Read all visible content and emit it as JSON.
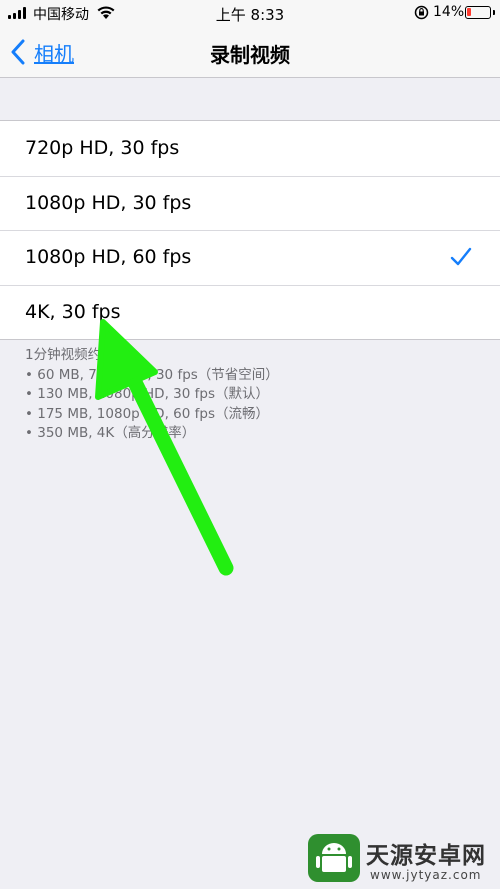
{
  "status_bar": {
    "carrier": "中国移动",
    "time": "上午 8:33",
    "battery_percent": "14%"
  },
  "nav": {
    "back_label": "相机",
    "title": "录制视频"
  },
  "options": [
    {
      "label": "720p HD, 30 fps",
      "selected": false
    },
    {
      "label": "1080p HD, 30 fps",
      "selected": false
    },
    {
      "label": "1080p HD, 60 fps",
      "selected": true
    },
    {
      "label": "4K, 30 fps",
      "selected": false
    }
  ],
  "footer": {
    "heading": "1分钟视频约",
    "lines": [
      "• 60 MB, 720p HD, 30 fps（节省空间）",
      "• 130 MB, 1080p HD, 30 fps（默认）",
      "• 175 MB, 1080p HD, 60 fps（流畅）",
      "• 350 MB, 4K（高分辨率）"
    ]
  },
  "watermark": {
    "name": "天源安卓网",
    "url": "www.jytyaz.com"
  },
  "colors": {
    "accent": "#157efb",
    "annotation_arrow": "#22ee11",
    "battery_low": "#ff3b30"
  },
  "icons": [
    "signal-icon",
    "wifi-icon",
    "orientation-lock-icon",
    "battery-icon",
    "chevron-left-icon",
    "checkmark-icon",
    "arrow-annotation"
  ]
}
